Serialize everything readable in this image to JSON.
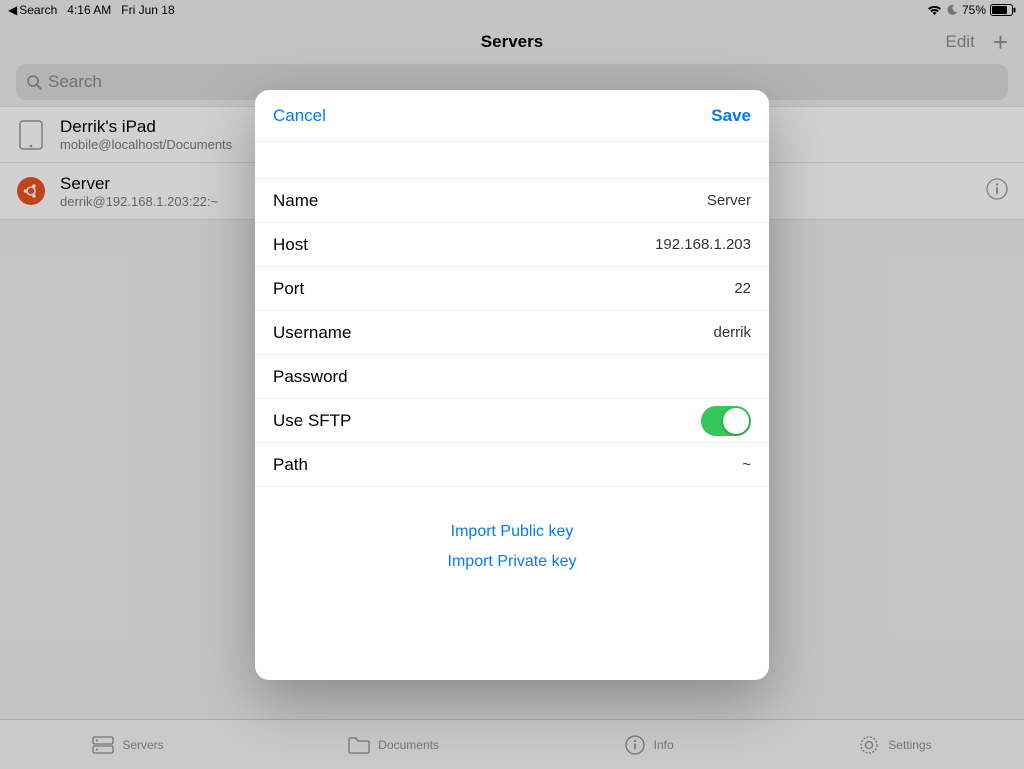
{
  "status": {
    "back_app": "Search",
    "time": "4:16 AM",
    "date": "Fri Jun 18",
    "battery_pct": "75%"
  },
  "nav": {
    "title": "Servers",
    "edit": "Edit"
  },
  "search": {
    "placeholder": "Search"
  },
  "list": {
    "items": [
      {
        "title": "Derrik's iPad",
        "subtitle": "mobile@localhost/Documents"
      },
      {
        "title": "Server",
        "subtitle": "derrik@192.168.1.203:22:~"
      }
    ]
  },
  "modal": {
    "cancel": "Cancel",
    "save": "Save",
    "fields": {
      "name_label": "Name",
      "name_value": "Server",
      "host_label": "Host",
      "host_value": "192.168.1.203",
      "port_label": "Port",
      "port_value": "22",
      "username_label": "Username",
      "username_value": "derrik",
      "password_label": "Password",
      "password_value": "",
      "sftp_label": "Use SFTP",
      "sftp_on": true,
      "path_label": "Path",
      "path_value": "~"
    },
    "import_public": "Import Public key",
    "import_private": "Import Private key"
  },
  "tabs": {
    "servers": "Servers",
    "documents": "Documents",
    "info": "Info",
    "settings": "Settings"
  }
}
